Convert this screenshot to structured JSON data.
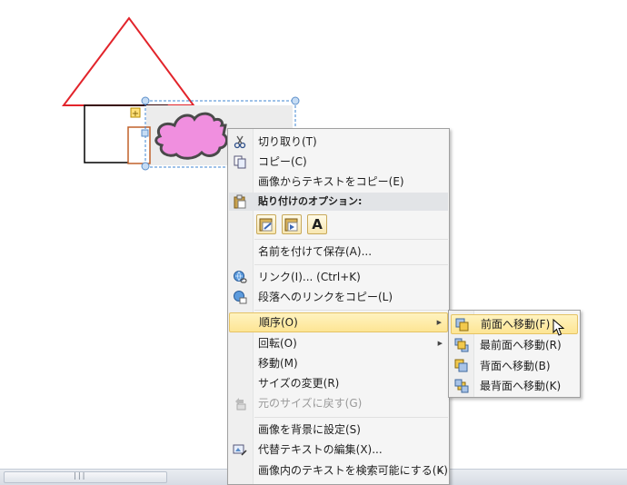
{
  "context_menu": {
    "items": [
      {
        "label": "切り取り(T)",
        "icon": "scissors-icon"
      },
      {
        "label": "コピー(C)",
        "icon": "copy-icon"
      },
      {
        "label": "画像からテキストをコピー(E)",
        "icon": ""
      },
      {
        "label": "リンク(I)...   (Ctrl+K)",
        "icon": "hyperlink-icon"
      },
      {
        "label": "段落へのリンクをコピー(L)",
        "icon": "link-copy-icon"
      },
      {
        "label": "順序(O)",
        "icon": "",
        "highlighted": true,
        "has_submenu": true
      },
      {
        "label": "回転(O)",
        "icon": "",
        "has_submenu": true
      },
      {
        "label": "移動(M)",
        "icon": ""
      },
      {
        "label": "サイズの変更(R)",
        "icon": ""
      },
      {
        "label": "元のサイズに戻す(G)",
        "icon": "reset-size-icon",
        "disabled": true
      },
      {
        "label": "画像を背景に設定(S)",
        "icon": ""
      },
      {
        "label": "代替テキストの編集(X)...",
        "icon": "alt-text-icon"
      },
      {
        "label": "画像内のテキストを検索可能にする(K)",
        "icon": "",
        "has_submenu": true
      }
    ],
    "paste_header": "貼り付けのオプション:",
    "paste_buttons": [
      "keep-formatting-icon",
      "merge-formatting-icon",
      "A"
    ],
    "save_as_label": "名前を付けて保存(A)..."
  },
  "order_submenu": {
    "items": [
      {
        "label": "前面へ移動(F)",
        "highlighted": true
      },
      {
        "label": "最前面へ移動(R)"
      },
      {
        "label": "背面へ移動(B)"
      },
      {
        "label": "最背面へ移動(K)"
      }
    ]
  },
  "colors": {
    "triangle_stroke": "#e2242b",
    "cloud_fill": "#f08fdf",
    "cloud_stroke": "#4a4a4a",
    "selection": "#3f86d0",
    "highlight": "#fde594"
  }
}
